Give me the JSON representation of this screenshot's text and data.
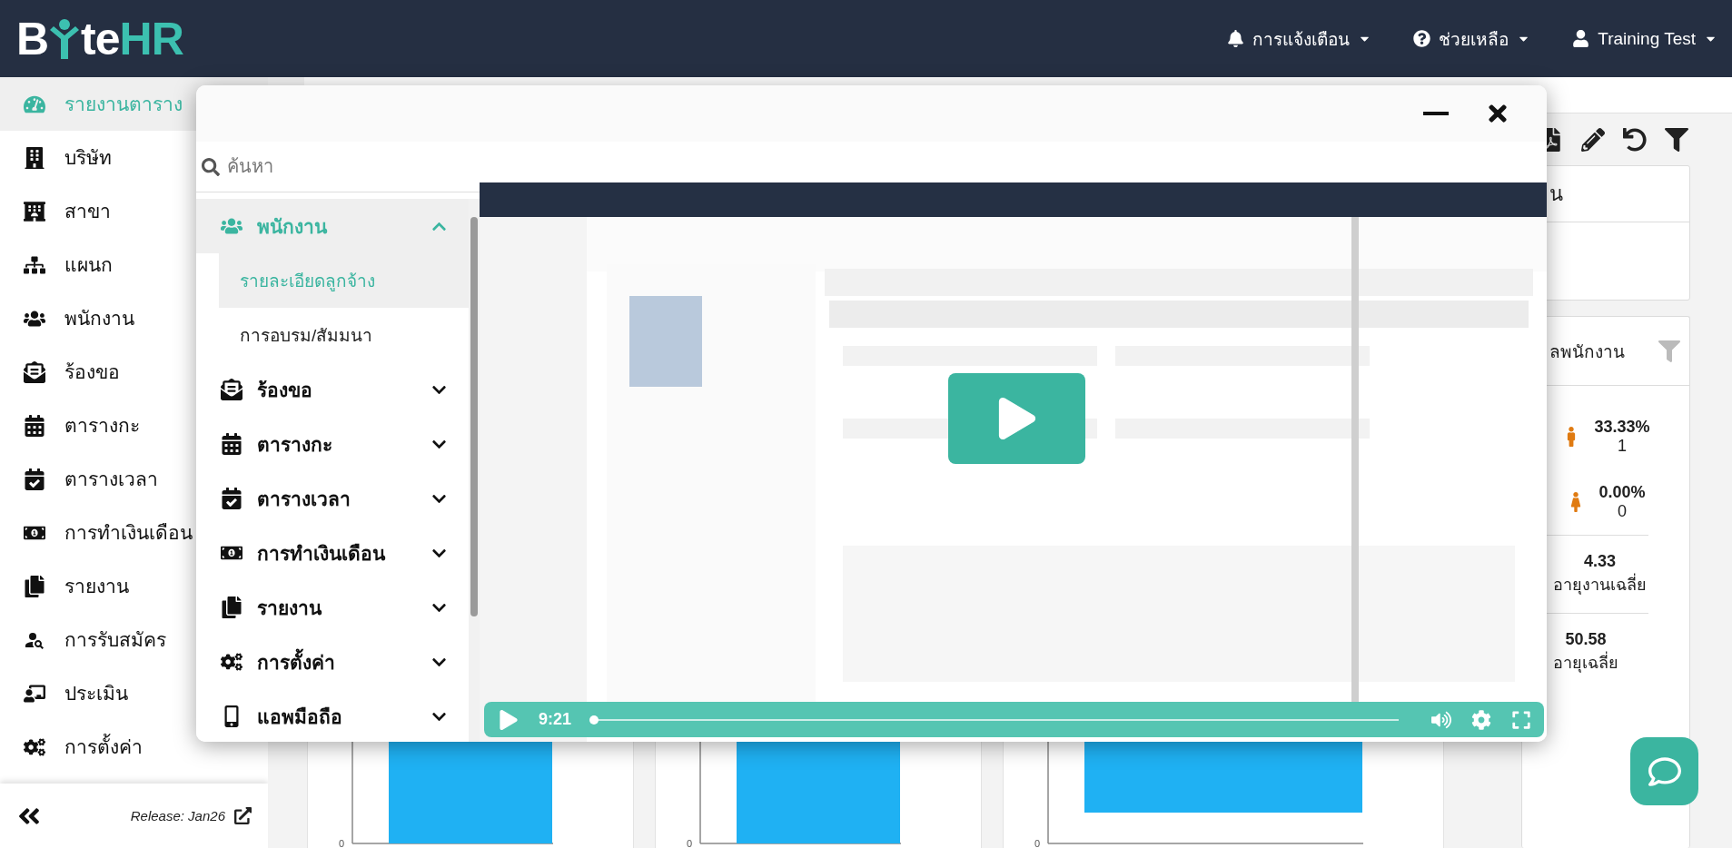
{
  "header": {
    "logo": {
      "lead": "B",
      "mid": "te",
      "accent": "HR"
    },
    "menus": [
      {
        "label": "การแจ้งเตือน"
      },
      {
        "label": "ช่วยเหลือ"
      },
      {
        "label": "Training Test"
      }
    ]
  },
  "sidebar": {
    "items": [
      {
        "label": "รายงานตาราง",
        "selected": true
      },
      {
        "label": "บริษัท",
        "selected": false
      },
      {
        "label": "สาขา",
        "selected": false
      },
      {
        "label": "แผนก",
        "selected": false
      },
      {
        "label": "พนักงาน",
        "selected": false
      },
      {
        "label": "ร้องขอ",
        "selected": false
      },
      {
        "label": "ตารางกะ",
        "selected": false
      },
      {
        "label": "ตารางเวลา",
        "selected": false
      },
      {
        "label": "การทำเงินเดือน",
        "selected": false
      },
      {
        "label": "รายงาน",
        "selected": false
      },
      {
        "label": "การรับสมัคร",
        "selected": false
      },
      {
        "label": "ประเมิน",
        "selected": false
      },
      {
        "label": "การตั้งค่า",
        "selected": false
      }
    ],
    "release": "Release: Jan26"
  },
  "cards": [
    {
      "title": "น"
    },
    {
      "title": "ลพนักงาน",
      "stats": [
        {
          "kind": "gender",
          "value": "33.33%",
          "count": "1"
        },
        {
          "kind": "gender",
          "value": "0.00%",
          "count": "0"
        },
        {
          "kind": "average",
          "value": "4.33",
          "label": "อายุงานเฉลี่ย"
        },
        {
          "kind": "average",
          "value": "50.58",
          "label": "อายุเฉลี่ย"
        }
      ]
    }
  ],
  "charts": [
    {
      "tick": "0"
    },
    {
      "tick": "0"
    },
    {
      "tick": "0"
    }
  ],
  "modal": {
    "search": {
      "placeholder": "ค้นหา"
    },
    "menu": [
      {
        "label": "พนักงาน",
        "expanded": true,
        "children": [
          {
            "label": "รายละเอียดลูกจ้าง",
            "selected": true
          },
          {
            "label": "การอบรม/สัมมนา",
            "selected": false
          }
        ]
      },
      {
        "label": "ร้องขอ",
        "expanded": false
      },
      {
        "label": "ตารางกะ",
        "expanded": false
      },
      {
        "label": "ตารางเวลา",
        "expanded": false
      },
      {
        "label": "การทำเงินเดือน",
        "expanded": false
      },
      {
        "label": "รายงาน",
        "expanded": false
      },
      {
        "label": "การตั้งค่า",
        "expanded": false
      },
      {
        "label": "แอพมือถือ",
        "expanded": false
      }
    ],
    "video": {
      "kind": "picture",
      "time": "9:21",
      "progress": {
        "level": 0
      }
    }
  }
}
